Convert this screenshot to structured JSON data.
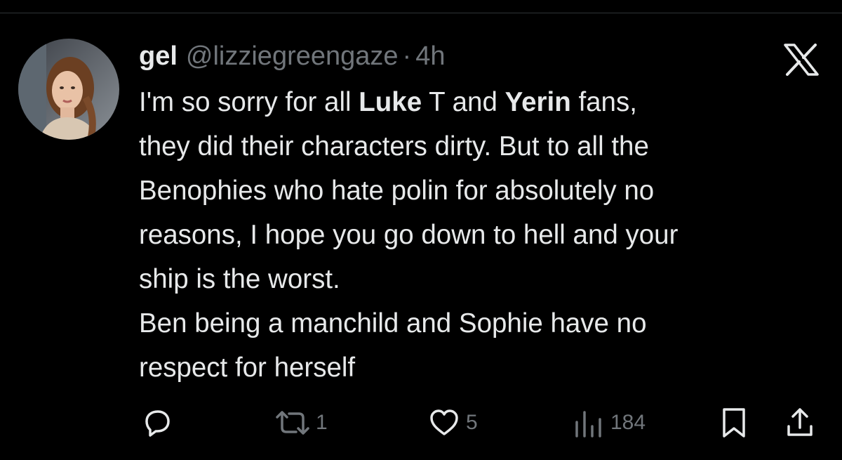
{
  "tweet": {
    "display_name": "gel",
    "handle": "@lizziegreengaze",
    "separator": "·",
    "time": "4h",
    "logo_icon": "x-logo-icon",
    "lines": [
      {
        "segments": [
          {
            "text": "I'm so sorry for all "
          },
          {
            "text": "Luke",
            "bold": true
          },
          {
            "text": " T and "
          },
          {
            "text": "Yerin",
            "bold": true
          },
          {
            "text": " fans,"
          }
        ]
      },
      {
        "segments": [
          {
            "text": "they did their characters dirty. But to all the"
          }
        ]
      },
      {
        "segments": [
          {
            "text": "Benophies who hate polin for absolutely no"
          }
        ]
      },
      {
        "segments": [
          {
            "text": "reasons, I hope you go down to hell and your"
          }
        ]
      },
      {
        "segments": [
          {
            "text": "ship is the worst."
          }
        ]
      },
      {
        "segments": [
          {
            "text": "Ben being a manchild and Sophie have no"
          }
        ]
      },
      {
        "segments": [
          {
            "text": "respect for herself"
          }
        ]
      }
    ]
  },
  "actions": {
    "reply": {
      "icon": "reply-icon"
    },
    "retweet": {
      "icon": "retweet-icon",
      "count": "1"
    },
    "like": {
      "icon": "heart-icon",
      "count": "5"
    },
    "views": {
      "icon": "views-icon",
      "count": "184"
    },
    "bookmark": {
      "icon": "bookmark-icon"
    },
    "share": {
      "icon": "share-icon"
    }
  },
  "colors": {
    "background": "#000000",
    "text": "#e7e9ea",
    "muted": "#71767b"
  }
}
